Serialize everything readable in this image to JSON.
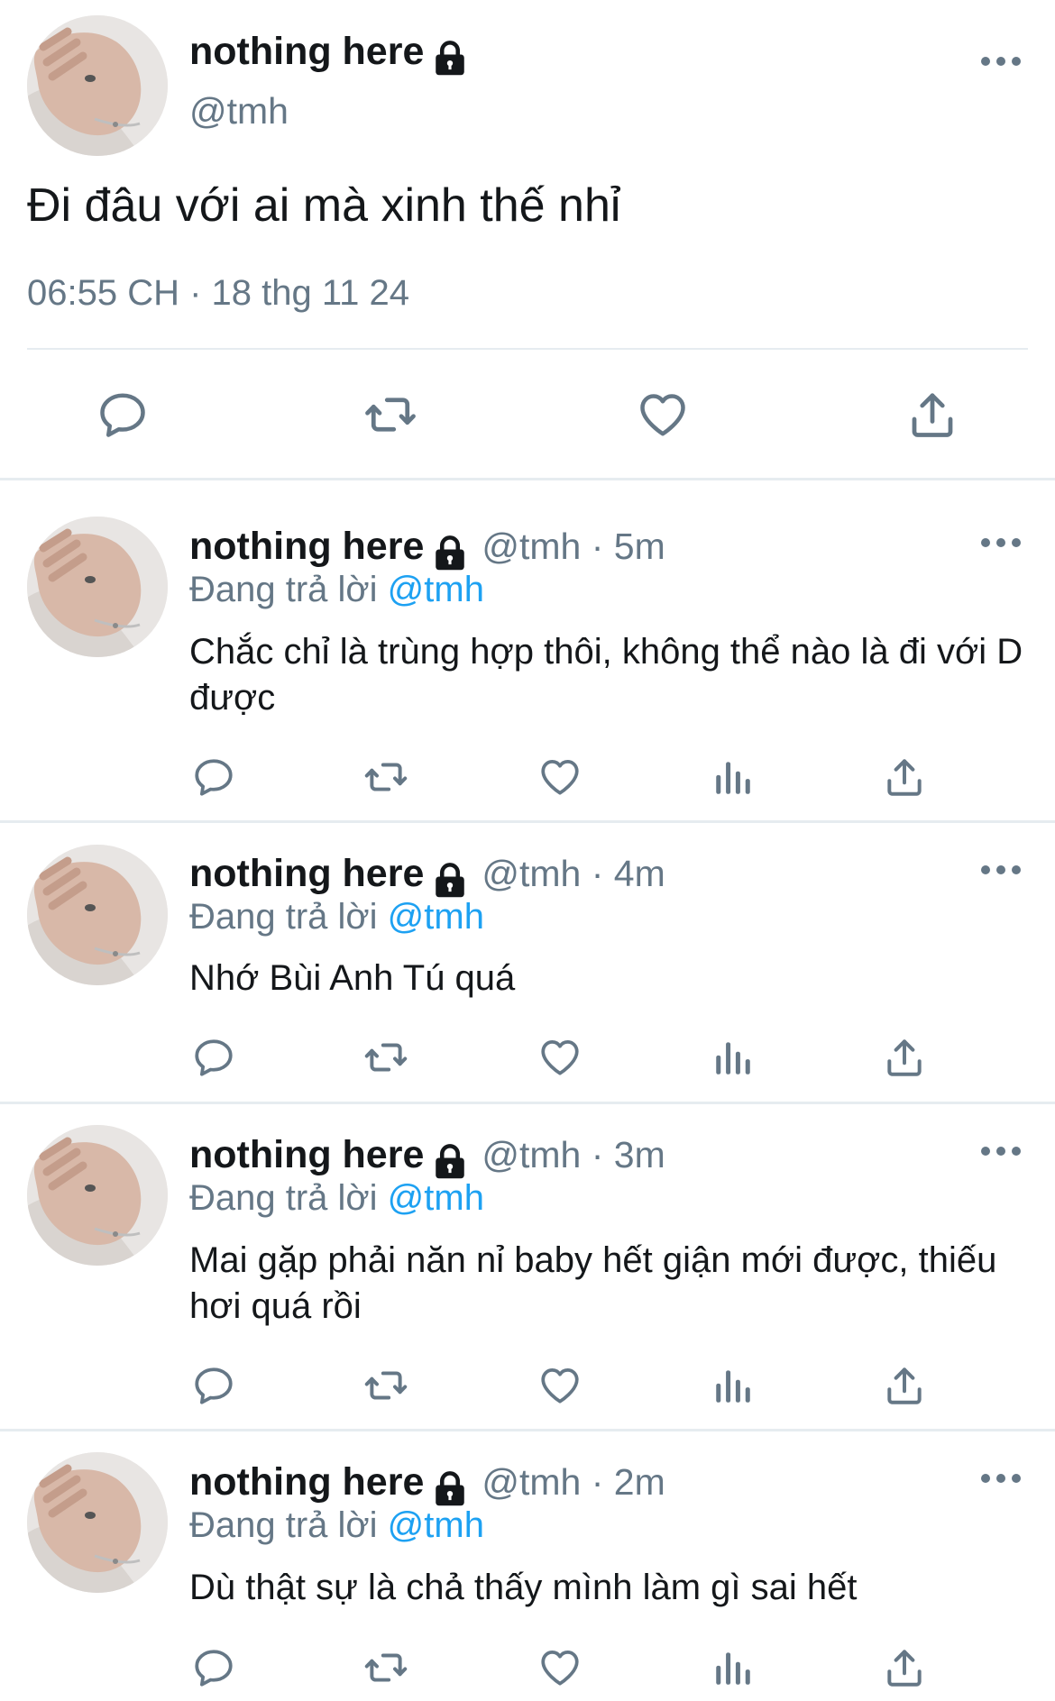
{
  "main_tweet": {
    "name": "nothing here",
    "handle": "@tmh",
    "text": "Đi đâu với ai mà xinh thế nhỉ",
    "timestamp": "06:55 CH · 18 thg 11 24"
  },
  "replies": [
    {
      "name": "nothing here",
      "handle_time": "@tmh · 5m",
      "replying_prefix": "Đang trả lời ",
      "replying_to": "@tmh",
      "text": "Chắc chỉ là trùng hợp thôi, không thể nào là đi với D được"
    },
    {
      "name": "nothing here",
      "handle_time": "@tmh · 4m",
      "replying_prefix": "Đang trả lời ",
      "replying_to": "@tmh",
      "text": "Nhớ Bùi Anh Tú quá"
    },
    {
      "name": "nothing here",
      "handle_time": "@tmh · 3m",
      "replying_prefix": "Đang trả lời ",
      "replying_to": "@tmh",
      "text": "Mai gặp phải năn nỉ baby hết giận mới được, thiếu hơi quá rồi"
    },
    {
      "name": "nothing here",
      "handle_time": "@tmh · 2m",
      "replying_prefix": "Đang trả lời ",
      "replying_to": "@tmh",
      "text": "Dù thật sự là chả thấy mình làm gì sai hết"
    }
  ],
  "icons": {
    "lock": "lock-icon",
    "more": "more-options-icon",
    "reply": "reply-icon",
    "retweet": "retweet-icon",
    "like": "heart-icon",
    "stats": "stats-icon",
    "share": "share-icon"
  },
  "colors": {
    "text": "#14171a",
    "secondary": "#657786",
    "mention": "#1da1f2",
    "divider": "#e6ecf0"
  }
}
